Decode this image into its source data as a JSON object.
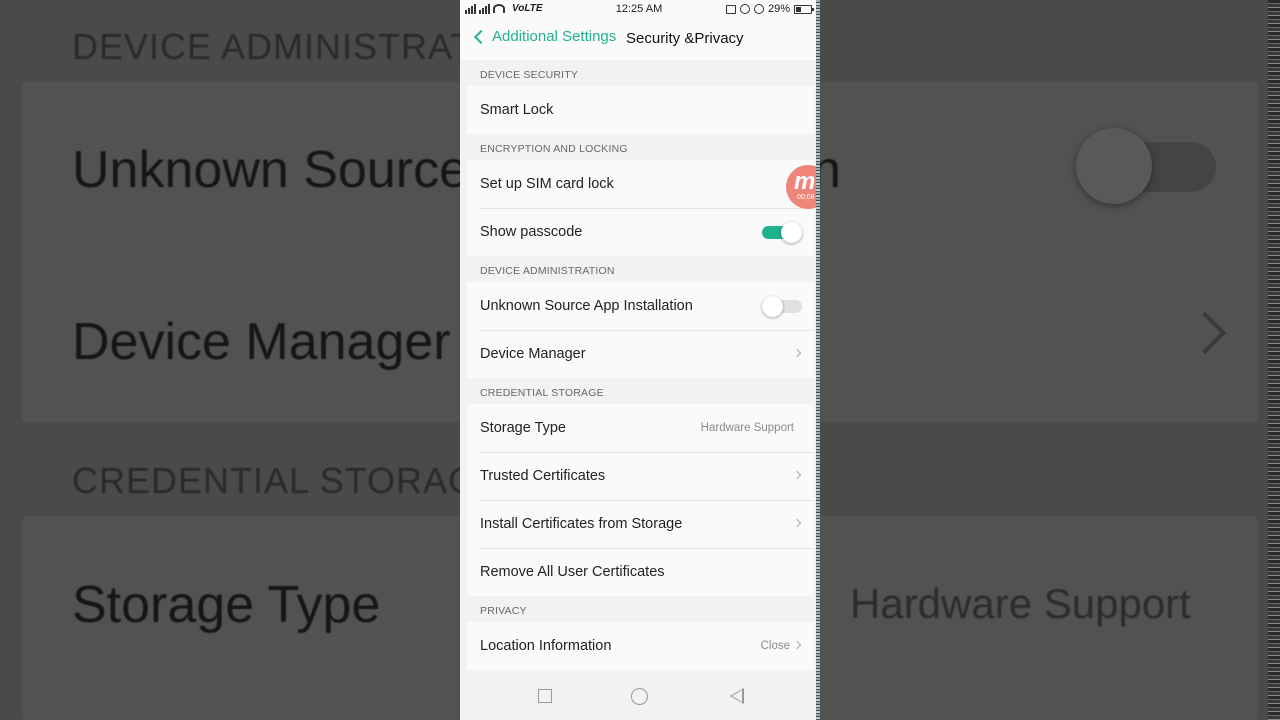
{
  "status_bar": {
    "network": "VoLTE",
    "time": "12:25 AM",
    "battery": "29%"
  },
  "header": {
    "back_label": "Additional Settings",
    "title": "Security &Privacy"
  },
  "sections": {
    "device_security": {
      "heading": "DEVICE SECURITY",
      "smart_lock": "Smart Lock"
    },
    "encryption": {
      "heading": "ENCRYPTION AND LOCKING",
      "sim_lock": "Set up SIM card lock",
      "show_passcode": "Show passcode",
      "show_passcode_on": true
    },
    "device_admin": {
      "heading": "DEVICE ADMINISTRATION",
      "unknown_source": "Unknown Source App Installation",
      "unknown_source_on": false,
      "device_manager": "Device Manager"
    },
    "credential_storage": {
      "heading": "CREDENTIAL STORAGE",
      "storage_type": "Storage Type",
      "storage_type_value": "Hardware Support",
      "trusted_certs": "Trusted Certificates",
      "install_certs": "Install Certificates from Storage",
      "remove_certs": "Remove All User Certificates"
    },
    "privacy": {
      "heading": "PRIVACY",
      "location": "Location Information",
      "location_value": "Close"
    }
  },
  "recorder_overlay": {
    "logo": "m",
    "timer": "00:08"
  },
  "background": {
    "heading_1": "DEVICE ADMINISTRAT",
    "row_1": "Unknown Source",
    "row_1_tail": "n",
    "row_2": "Device Manager",
    "heading_2": "CREDENTIAL STORAG",
    "row_3": "Storage Type",
    "row_3_value": "Hardware Support"
  },
  "colors": {
    "accent": "#20b290",
    "page_bg": "#f2f2f2",
    "card_bg": "#fafafa"
  }
}
